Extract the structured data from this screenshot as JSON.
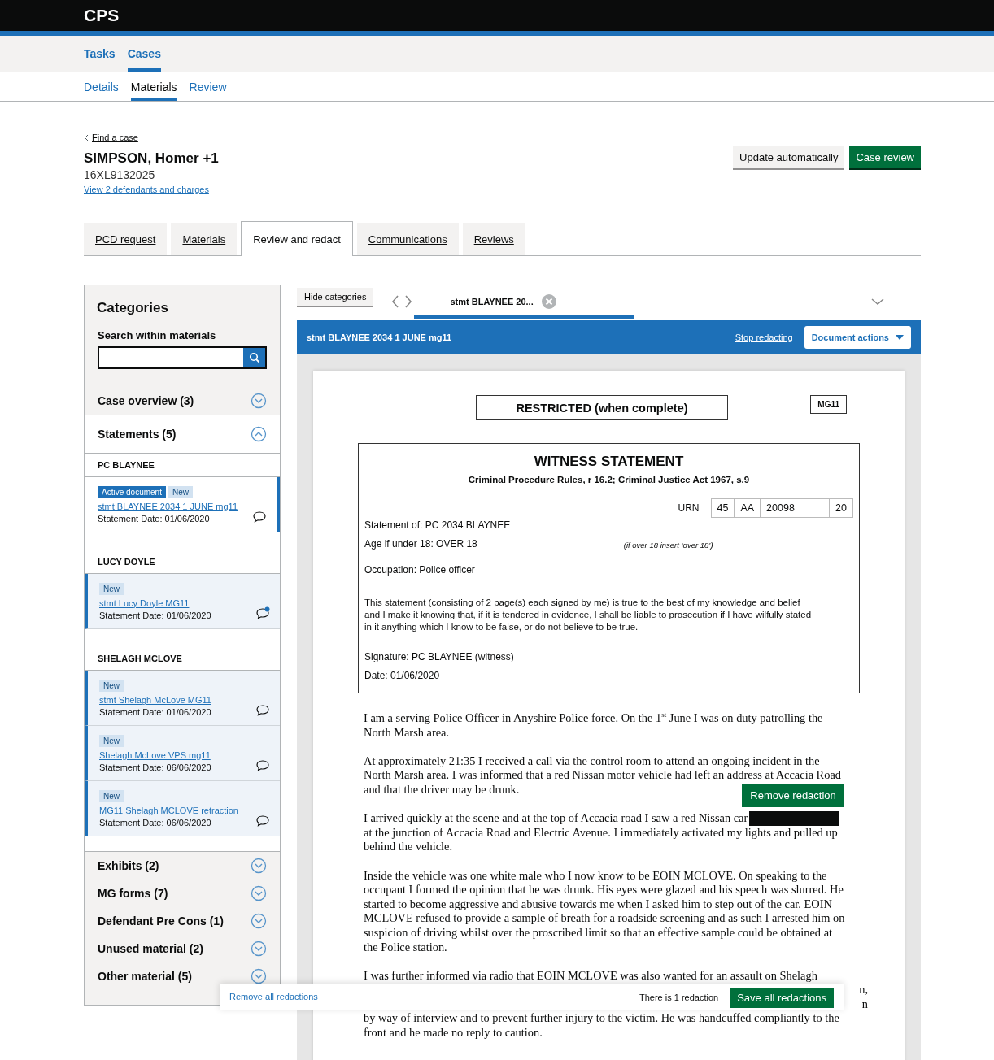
{
  "header": {
    "logo": "CPS"
  },
  "primary_nav": [
    {
      "label": "Tasks",
      "selected": false
    },
    {
      "label": "Cases",
      "selected": true
    }
  ],
  "sub_nav": [
    {
      "label": "Details",
      "selected": false
    },
    {
      "label": "Materials",
      "selected": true
    },
    {
      "label": "Review",
      "selected": false
    }
  ],
  "breadcrumb": "Find a case",
  "case": {
    "name": "SIMPSON, Homer +1",
    "urn": "16XL9132025",
    "link": "View 2 defendants and charges"
  },
  "actions": [
    {
      "label": "Update automatically",
      "kind": "secondary"
    },
    {
      "label": "Case review",
      "kind": "primary"
    }
  ],
  "tabs": [
    {
      "label": "PCD request",
      "selected": false
    },
    {
      "label": "Materials",
      "selected": false
    },
    {
      "label": "Review and redact",
      "selected": true
    },
    {
      "label": "Communications",
      "selected": false
    },
    {
      "label": "Reviews",
      "selected": false
    }
  ],
  "sidebar": {
    "title": "Categories",
    "search_label": "Search within materials",
    "categories": [
      {
        "label": "Case overview (3)",
        "expanded": false
      },
      {
        "label": "Statements (5)",
        "expanded": true,
        "groups": [
          {
            "name": "PC BLAYNEE",
            "documents": [
              {
                "title": "stmt BLAYNEE 2034 1 JUNE mg11",
                "date": "Statement Date: 01/06/2020",
                "active": true,
                "unread_comment": false,
                "badges": [
                  {
                    "label": "Active document",
                    "kind": "active"
                  },
                  {
                    "label": "New",
                    "kind": "new"
                  }
                ]
              }
            ]
          },
          {
            "name": "LUCY DOYLE",
            "documents": [
              {
                "title": "stmt Lucy Doyle MG11",
                "date": "Statement Date: 01/06/2020",
                "active": false,
                "unread_comment": true,
                "badges": [
                  {
                    "label": "New",
                    "kind": "new"
                  }
                ]
              }
            ]
          },
          {
            "name": "SHELAGH MCLOVE",
            "documents": [
              {
                "title": "stmt Shelagh McLove MG11",
                "date": "Statement Date: 01/06/2020",
                "active": false,
                "unread_comment": false,
                "badges": [
                  {
                    "label": "New",
                    "kind": "new"
                  }
                ]
              },
              {
                "title": "Shelagh McLove VPS mg11",
                "date": "Statement Date: 06/06/2020",
                "active": false,
                "unread_comment": false,
                "badges": [
                  {
                    "label": "New",
                    "kind": "new"
                  }
                ]
              },
              {
                "title": "MG11 Shelagh MCLOVE retraction",
                "date": "Statement Date: 06/06/2020",
                "active": false,
                "unread_comment": false,
                "badges": [
                  {
                    "label": "New",
                    "kind": "new"
                  }
                ]
              }
            ]
          }
        ]
      },
      {
        "label": "Exhibits (2)",
        "expanded": false
      },
      {
        "label": "MG forms (7)",
        "expanded": false
      },
      {
        "label": "Defendant Pre Cons (1)",
        "expanded": false
      },
      {
        "label": "Unused material (2)",
        "expanded": false
      },
      {
        "label": "Other material (5)",
        "expanded": false
      }
    ]
  },
  "viewer": {
    "hide_button": "Hide categories",
    "doc_tabs": [
      {
        "label": "stmt BLAYNEE 20...",
        "selected": true
      }
    ],
    "title": "stmt BLAYNEE 2034 1 JUNE mg11",
    "stop_link": "Stop redacting",
    "actions_button": "Document actions",
    "document": {
      "restriction": "RESTRICTED (when complete)",
      "form": "MG11",
      "heading": "WITNESS STATEMENT",
      "subheading": "Criminal Procedure Rules, r 16.2; Criminal Justice Act 1967, s.9",
      "urn_label": "URN",
      "urn_parts": [
        "45",
        "AA",
        "20098",
        "20"
      ],
      "statement_of": "Statement of: PC 2034 BLAYNEE",
      "age": "Age if under 18: OVER 18",
      "age_hint": "(if over 18 insert ‘over 18’)",
      "occupation": "Occupation:  Police officer",
      "declaration": [
        "This statement (consisting of 2 page(s) each signed by me) is true to the best of my knowledge and belief",
        "and I make it knowing that, if it is tendered in evidence, I shall be liable to prosecution if I have wilfully stated",
        "in it anything which I know to be false, or do not believe to be true."
      ],
      "signature": "Signature: PC BLAYNEE (witness)",
      "date": "Date:  01/06/2020",
      "paragraphs": [
        {
          "lines": [
            {
              "kind": "text",
              "text": "I am a serving Police Officer in Anyshire Police force. On the 1$^{st}$ June I was on duty patrolling the"
            },
            {
              "kind": "text",
              "text": "North Marsh area."
            }
          ]
        },
        {
          "lines": [
            {
              "kind": "text",
              "text": "At approximately 21:35 I received a call via the control room to attend an ongoing incident in the"
            },
            {
              "kind": "text",
              "text": "North Marsh area. I was informed that a red Nissan motor vehicle had left an address at Accacia Road"
            },
            {
              "kind": "text",
              "text": "and that the driver may be drunk."
            }
          ]
        },
        {
          "lines": [
            {
              "kind": "redacted",
              "text": "I arrived quickly at the scene and at the top of Accacia road I saw a red Nissan car"
            },
            {
              "kind": "text",
              "text": "at the junction of Accacia Road and Electric Avenue. I immediately activated my lights and pulled up"
            },
            {
              "kind": "text",
              "text": "behind the vehicle."
            }
          ]
        },
        {
          "lines": [
            {
              "kind": "text",
              "text": "Inside the vehicle was one white male who I now know to be EOIN MCLOVE. On speaking to the"
            },
            {
              "kind": "text",
              "text": "occupant I formed the opinion that he was drunk. His eyes were glazed and his speech was slurred. He"
            },
            {
              "kind": "text",
              "text": "started to become aggressive and abusive towards me when I asked him to step out of the car. EOIN"
            },
            {
              "kind": "text",
              "text": "MCLOVE refused to provide a sample of breath for a roadside screening and as such I arrested him on"
            },
            {
              "kind": "text",
              "text": "suspicion of driving whilst over the proscribed limit so that an effective sample could be obtained at"
            },
            {
              "kind": "text",
              "text": "the Police station."
            }
          ]
        },
        {
          "lines": [
            {
              "kind": "text",
              "text": "I was further informed via radio that EOIN MCLOVE was also wanted for an assault on Shelagh"
            },
            {
              "kind": "covered",
              "text": "n,"
            },
            {
              "kind": "covered",
              "text": "n"
            },
            {
              "kind": "text",
              "text": "by way of interview and to prevent further injury to the victim. He was handcuffed compliantly to the"
            },
            {
              "kind": "text",
              "text": "front and he made no reply to caution."
            }
          ]
        }
      ],
      "redaction_tooltip": "Remove redaction"
    }
  },
  "redaction_bar": {
    "remove_all": "Remove all redactions",
    "count": "There is 1 redaction",
    "save": "Save all redactions"
  }
}
